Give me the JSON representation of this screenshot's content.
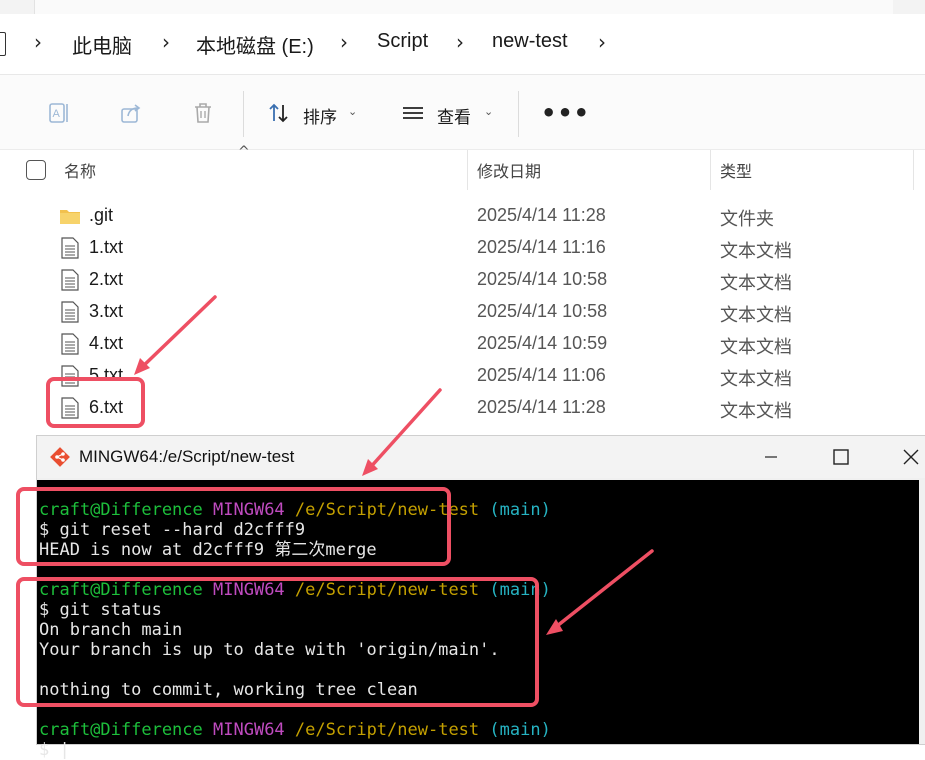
{
  "breadcrumb": {
    "items": [
      "此电脑",
      "本地磁盘 (E:)",
      "Script",
      "new-test"
    ]
  },
  "toolbar": {
    "sort_label": "排序",
    "view_label": "查看",
    "more_label": "•••"
  },
  "file_list": {
    "columns": {
      "name": "名称",
      "modified": "修改日期",
      "type": "类型"
    },
    "rows": [
      {
        "name": ".git",
        "modified": "2025/4/14 11:28",
        "type": "文件夹",
        "icon": "folder-icon"
      },
      {
        "name": "1.txt",
        "modified": "2025/4/14 11:16",
        "type": "文本文档",
        "icon": "text-file-icon"
      },
      {
        "name": "2.txt",
        "modified": "2025/4/14 10:58",
        "type": "文本文档",
        "icon": "text-file-icon"
      },
      {
        "name": "3.txt",
        "modified": "2025/4/14 10:58",
        "type": "文本文档",
        "icon": "text-file-icon"
      },
      {
        "name": "4.txt",
        "modified": "2025/4/14 10:59",
        "type": "文本文档",
        "icon": "text-file-icon"
      },
      {
        "name": "5.txt",
        "modified": "2025/4/14 11:06",
        "type": "文本文档",
        "icon": "text-file-icon"
      },
      {
        "name": "6.txt",
        "modified": "2025/4/14 11:28",
        "type": "文本文档",
        "icon": "text-file-icon"
      }
    ]
  },
  "terminal": {
    "title": "MINGW64:/e/Script/new-test",
    "prompt": {
      "user": "craft@Difference",
      "shell": "MINGW64",
      "path": "/e/Script/new-test",
      "branch": "(main)"
    },
    "lines": [
      "$ git reset --hard d2cfff9",
      "HEAD is now at d2cfff9 第二次merge",
      "$ git status",
      "On branch main",
      "Your branch is up to date with 'origin/main'.",
      "nothing to commit, working tree clean",
      "$ |"
    ]
  },
  "colors": {
    "annotation": "#ee4f63",
    "prompt_user": "#1dbf3b",
    "prompt_shell": "#c04bc0",
    "prompt_path": "#c4a000",
    "prompt_branch": "#26b3c2",
    "folder": "#f2c14e"
  }
}
